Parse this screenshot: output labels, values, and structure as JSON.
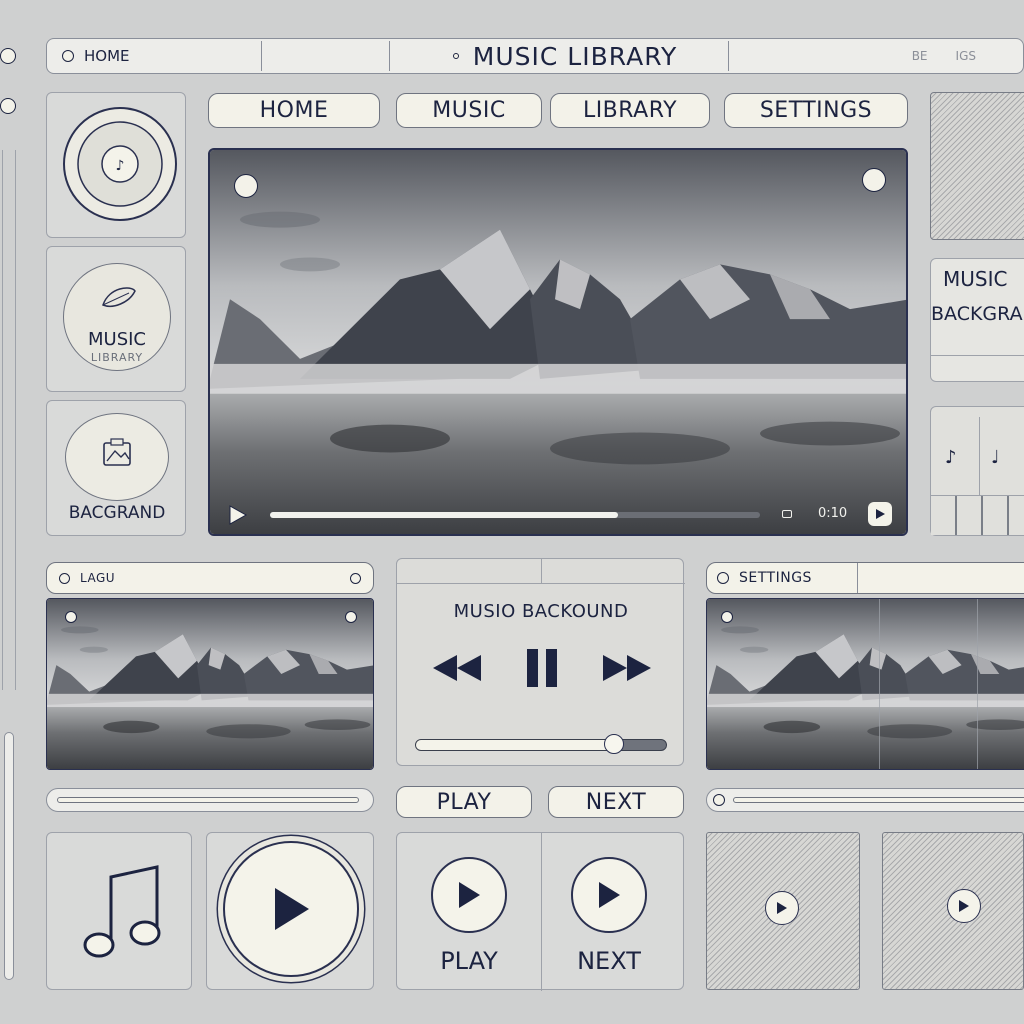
{
  "header": {
    "home_label": "HOME",
    "title": "MUSIC LIBRARY",
    "right_faint_1": "BE",
    "right_faint_2": "IGS"
  },
  "nav": {
    "tabs": [
      {
        "label": "HOME"
      },
      {
        "label": "MUSIC"
      },
      {
        "label": "LIBRARY"
      },
      {
        "label": "SETTINGS"
      }
    ]
  },
  "left_sidebar": {
    "music_card_title": "MUSIC",
    "music_card_sub": "LIBRARY",
    "background_card_label": "BACGRAND"
  },
  "right_sidebar": {
    "card_line1": "MUSIC",
    "card_line2": "BACKGRAND"
  },
  "main_player": {
    "progress_fraction": 0.71,
    "time_text": "0:10"
  },
  "lower_left": {
    "header_label": "LAGU"
  },
  "lower_center": {
    "title": "MUSIO BACKOUND",
    "volume_fraction": 0.79
  },
  "lower_right": {
    "header_label": "SETTINGS"
  },
  "buttons": {
    "play_label": "PLAY",
    "next_label": "NEXT"
  },
  "bottom_controls": {
    "play_label": "PLAY",
    "next_label": "NEXT"
  },
  "colors": {
    "accent_navy": "#1c2340",
    "panel_bg": "#d9dad9",
    "pill_bg": "#f3f2e9"
  },
  "icons": [
    "music-note-icon",
    "play-icon",
    "pause-icon",
    "rewind-icon",
    "fast-forward-icon",
    "image-icon",
    "disc-icon"
  ]
}
